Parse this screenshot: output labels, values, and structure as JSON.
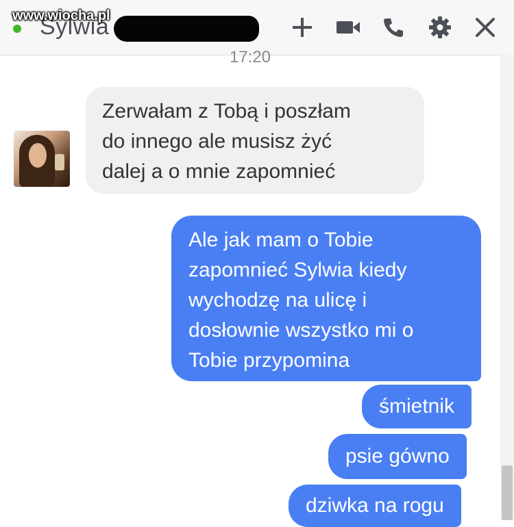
{
  "watermark": "www.wiocha.pl",
  "header": {
    "contact_name": "Sylwia",
    "online": true
  },
  "icons": [
    "add-icon",
    "video-call-icon",
    "phone-call-icon",
    "settings-gear-icon",
    "close-icon"
  ],
  "colors": {
    "sent_bubble": "#4a7ff4",
    "received_bubble": "#f1f0f0",
    "online_dot": "#42b72a",
    "header_icons": "#4b4f56"
  },
  "conversation": {
    "timestamp": "17:20",
    "received": {
      "lines": [
        "Zerwałam z Tobą i poszłam",
        "do innego ale musisz żyć",
        "dalej a o mnie zapomnieć"
      ]
    },
    "sent": [
      {
        "lines": [
          "Ale jak mam o Tobie",
          "zapomnieć Sylwia kiedy",
          "wychodzę na ulicę i",
          "dosłownie wszystko mi o",
          "Tobie przypomina"
        ]
      },
      {
        "text": "śmietnik"
      },
      {
        "text": "psie gówno"
      },
      {
        "text": "dziwka na rogu"
      }
    ]
  }
}
